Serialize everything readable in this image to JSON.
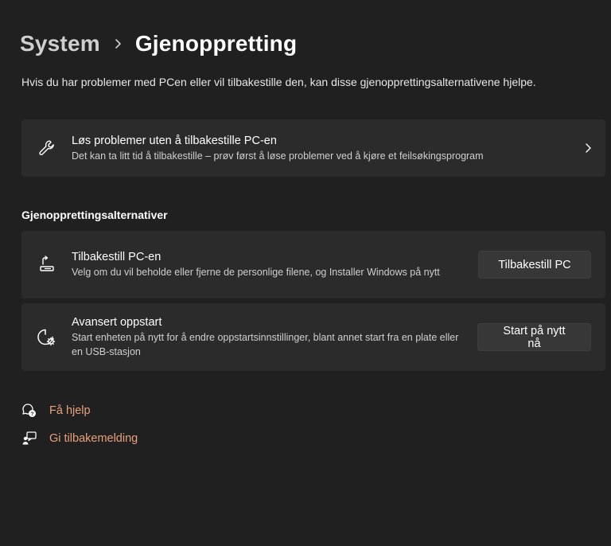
{
  "breadcrumb": {
    "parent": "System",
    "current": "Gjenoppretting"
  },
  "description": "Hvis du har problemer med PCen eller vil tilbakestille den, kan disse gjenopprettingsalternativene hjelpe.",
  "troubleshoot": {
    "title": "Løs problemer uten å tilbakestille PC-en",
    "subtitle": "Det kan ta litt tid å tilbakestille – prøv først å løse problemer ved å kjøre et feilsøkingsprogram",
    "icon": "wrench-icon"
  },
  "recovery_options": {
    "heading": "Gjenopprettingsalternativer",
    "items": [
      {
        "title": "Tilbakestill PC-en",
        "subtitle": "Velg om du vil beholde eller fjerne de personlige filene, og Installer Windows på nytt",
        "button_label": "Tilbakestill PC",
        "icon": "reset-pc-icon"
      },
      {
        "title": "Avansert oppstart",
        "subtitle": "Start enheten på nytt for å endre oppstartsinnstillinger, blant annet start fra en plate eller en USB-stasjon",
        "button_label": "Start på nytt nå",
        "icon": "advanced-startup-icon"
      }
    ]
  },
  "links": {
    "help": "Få hjelp",
    "feedback": "Gi tilbakemelding"
  },
  "colors": {
    "background": "#202020",
    "card": "#2b2b2b",
    "button": "#373737",
    "link": "#e9a07d"
  }
}
